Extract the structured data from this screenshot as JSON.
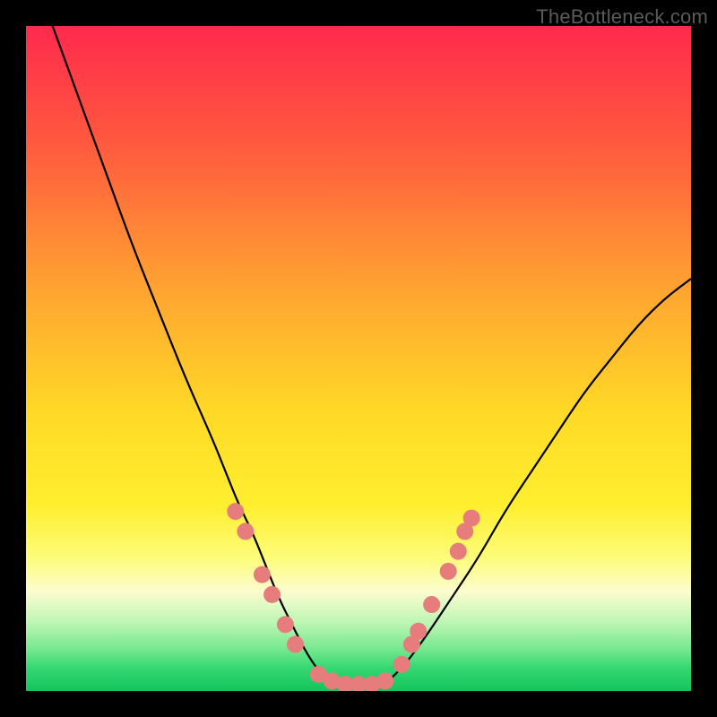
{
  "watermark": "TheBottleneck.com",
  "chart_data": {
    "type": "line",
    "title": "",
    "xlabel": "",
    "ylabel": "",
    "xlim": [
      0,
      100
    ],
    "ylim": [
      0,
      100
    ],
    "series": [
      {
        "name": "left-curve",
        "x": [
          4,
          8,
          12,
          16,
          20,
          24,
          28,
          30,
          32,
          34,
          36,
          38,
          40,
          42,
          44,
          45
        ],
        "y": [
          100,
          89,
          78,
          67,
          57,
          47,
          38,
          33,
          28,
          24,
          19,
          14,
          10,
          6,
          3,
          2
        ]
      },
      {
        "name": "right-curve",
        "x": [
          55,
          57,
          60,
          64,
          68,
          72,
          76,
          80,
          84,
          88,
          92,
          96,
          100
        ],
        "y": [
          2,
          4,
          8,
          14,
          20,
          27,
          33,
          39,
          45,
          50,
          55,
          59,
          62
        ]
      },
      {
        "name": "trough",
        "x": [
          45,
          47,
          49,
          51,
          53,
          55
        ],
        "y": [
          2,
          1,
          1,
          1,
          1,
          2
        ]
      }
    ],
    "markers": {
      "name": "highlighted-points",
      "color": "#e77c7c",
      "points": [
        {
          "x": 31.5,
          "y": 27
        },
        {
          "x": 33,
          "y": 24
        },
        {
          "x": 35.5,
          "y": 17.5
        },
        {
          "x": 37,
          "y": 14.5
        },
        {
          "x": 39,
          "y": 10
        },
        {
          "x": 40.5,
          "y": 7
        },
        {
          "x": 44,
          "y": 2.5
        },
        {
          "x": 46,
          "y": 1.5
        },
        {
          "x": 48,
          "y": 1
        },
        {
          "x": 50,
          "y": 1
        },
        {
          "x": 52,
          "y": 1
        },
        {
          "x": 54,
          "y": 1.5
        },
        {
          "x": 56.5,
          "y": 4
        },
        {
          "x": 58,
          "y": 7
        },
        {
          "x": 59,
          "y": 9
        },
        {
          "x": 61,
          "y": 13
        },
        {
          "x": 63.5,
          "y": 18
        },
        {
          "x": 65,
          "y": 21
        },
        {
          "x": 66,
          "y": 24
        },
        {
          "x": 67,
          "y": 26
        }
      ]
    },
    "gradient_stops": [
      {
        "offset": 0,
        "color": "#ff2a4d"
      },
      {
        "offset": 0.18,
        "color": "#ff5a3e"
      },
      {
        "offset": 0.4,
        "color": "#ffa531"
      },
      {
        "offset": 0.58,
        "color": "#ffd926"
      },
      {
        "offset": 0.72,
        "color": "#ffef2f"
      },
      {
        "offset": 0.8,
        "color": "#fdfc7a"
      },
      {
        "offset": 0.85,
        "color": "#fcfccf"
      },
      {
        "offset": 0.9,
        "color": "#b8f5b2"
      },
      {
        "offset": 0.94,
        "color": "#6fe78b"
      },
      {
        "offset": 0.965,
        "color": "#35d873"
      },
      {
        "offset": 1.0,
        "color": "#13c55c"
      }
    ]
  }
}
